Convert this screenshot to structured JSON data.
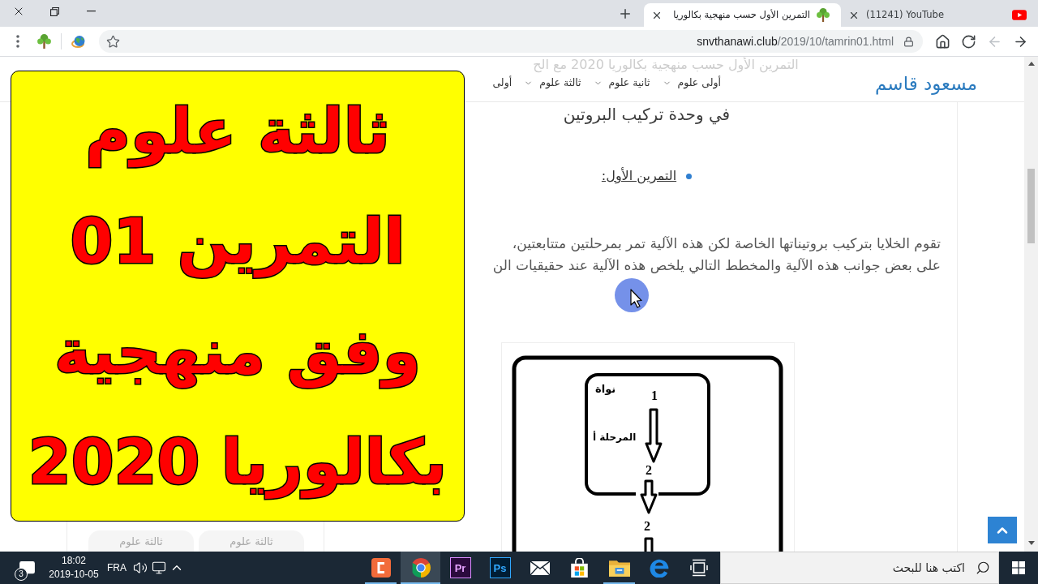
{
  "browser": {
    "tabs": [
      {
        "kind": "youtube",
        "title": "(11241) YouTube",
        "selected": false
      },
      {
        "kind": "site",
        "title": "التمرين الأول حسب منهجية بكالوريا",
        "selected": true
      }
    ],
    "navigation": [
      {
        "kind": "back",
        "disabled": false
      },
      {
        "kind": "forward",
        "disabled": true
      },
      {
        "kind": "reload",
        "disabled": false
      },
      {
        "kind": "home",
        "disabled": false
      }
    ],
    "address": {
      "domain": "snvthanawi.club",
      "path": "/2019/10/tamrin01.html"
    }
  },
  "page": {
    "background_title": "التمرين الأول حسب منهجية بكالوريا 2020 مع الح",
    "header": {
      "brand": "مسعود قاسم",
      "menu": [
        {
          "label": "أولى علوم",
          "dropdown": true
        },
        {
          "label": "ثانية علوم",
          "dropdown": true
        },
        {
          "label": "ثالثة علوم",
          "dropdown": true
        },
        {
          "label": "أولى",
          "dropdown": false
        }
      ]
    },
    "subtitle": "في وحدة تركيب البروتين",
    "exercise_heading": "التمرين الأول:",
    "paragraph_lines": [
      "تقوم الخلايا بتركيب بروتيناتها الخاصة لكن هذه الآلية تمر بمرحلتين متتابعتين،",
      "على بعض جوانب هذه الآلية والمخطط التالي يلخص هذه الآلية عند حقيقيات الن"
    ],
    "diagram": {
      "nucleus_label": "نواة",
      "phase_label": "المرحلة أ",
      "step_numbers": [
        "1",
        "2",
        "2"
      ]
    },
    "sidebar_tags": [
      "ثالثة علوم",
      "ثالثة علوم"
    ]
  },
  "overlay": {
    "lines": [
      "ثالثة علوم",
      "التمرين 01",
      "وفق منهجية",
      "بكالوريا 2020"
    ]
  },
  "taskbar": {
    "search": {
      "placeholder": "اكتب هنا للبحث"
    },
    "apps": [
      {
        "kind": "task_view",
        "running": false,
        "selected": false
      },
      {
        "kind": "edge",
        "running": false,
        "selected": false
      },
      {
        "kind": "explorer",
        "running": true,
        "selected": false
      },
      {
        "kind": "store",
        "running": false,
        "selected": false
      },
      {
        "kind": "mail",
        "running": false,
        "selected": false
      },
      {
        "kind": "photoshop",
        "label": "Ps",
        "running": false,
        "selected": false
      },
      {
        "kind": "premiere",
        "label": "Pr",
        "running": false,
        "selected": false
      },
      {
        "kind": "chrome",
        "running": true,
        "selected": true
      },
      {
        "kind": "clipchamp",
        "running": true,
        "selected": false
      }
    ],
    "input_language": "FRA",
    "time": "18:02",
    "date": "2019-10-05",
    "notification_count": "3"
  }
}
